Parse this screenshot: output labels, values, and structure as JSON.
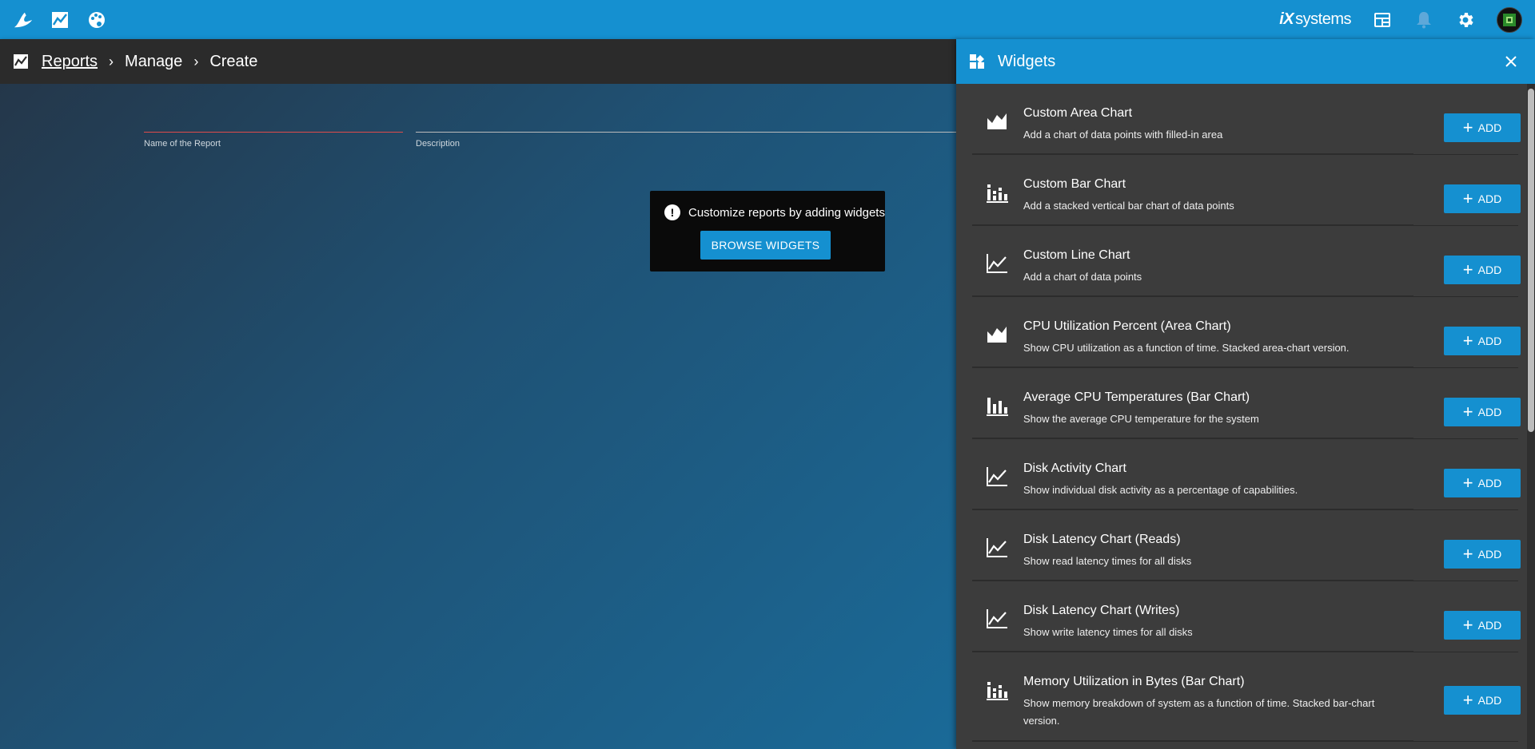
{
  "topbar": {
    "brand_prefix": "iX",
    "brand_suffix": "systems",
    "icons": [
      "freenas-logo-icon",
      "reports-icon",
      "palette-icon",
      "guide-icon",
      "bell-icon",
      "gear-icon",
      "avatar"
    ]
  },
  "breadcrumb": {
    "items": [
      "Reports",
      "Manage",
      "Create"
    ]
  },
  "form": {
    "name_label": "Name of the Report",
    "description_label": "Description"
  },
  "toast": {
    "message": "Customize reports by adding widgets",
    "button": "BROWSE WIDGETS"
  },
  "panel": {
    "title": "Widgets",
    "add_label": "ADD",
    "widgets": [
      {
        "title": "Custom Area Chart",
        "desc": "Add a chart of data points with filled-in area",
        "icon": "area-chart-icon"
      },
      {
        "title": "Custom Bar Chart",
        "desc": "Add a stacked vertical bar chart of data points",
        "icon": "stacked-bar-chart-icon"
      },
      {
        "title": "Custom Line Chart",
        "desc": "Add a chart of data points",
        "icon": "line-chart-icon"
      },
      {
        "title": "CPU Utilization Percent (Area Chart)",
        "desc": "Show CPU utilization as a function of time. Stacked area-chart version.",
        "icon": "area-chart-icon"
      },
      {
        "title": "Average CPU Temperatures (Bar Chart)",
        "desc": "Show the average CPU temperature for the system",
        "icon": "bar-chart-icon"
      },
      {
        "title": "Disk Activity Chart",
        "desc": "Show individual disk activity as a percentage of capabilities.",
        "icon": "line-chart-icon"
      },
      {
        "title": "Disk Latency Chart (Reads)",
        "desc": "Show read latency times for all disks",
        "icon": "line-chart-icon"
      },
      {
        "title": "Disk Latency Chart (Writes)",
        "desc": "Show write latency times for all disks",
        "icon": "line-chart-icon"
      },
      {
        "title": "Memory Utilization in Bytes (Bar Chart)",
        "desc": "Show memory breakdown of system as a function of time. Stacked bar-chart version.",
        "icon": "stacked-bar-chart-icon"
      }
    ]
  },
  "colors": {
    "primary": "#1590d0",
    "panel_bg": "#3c3c3c",
    "breadcrumb_bg": "#2b2b2b",
    "error_underline": "#e04b4b"
  }
}
